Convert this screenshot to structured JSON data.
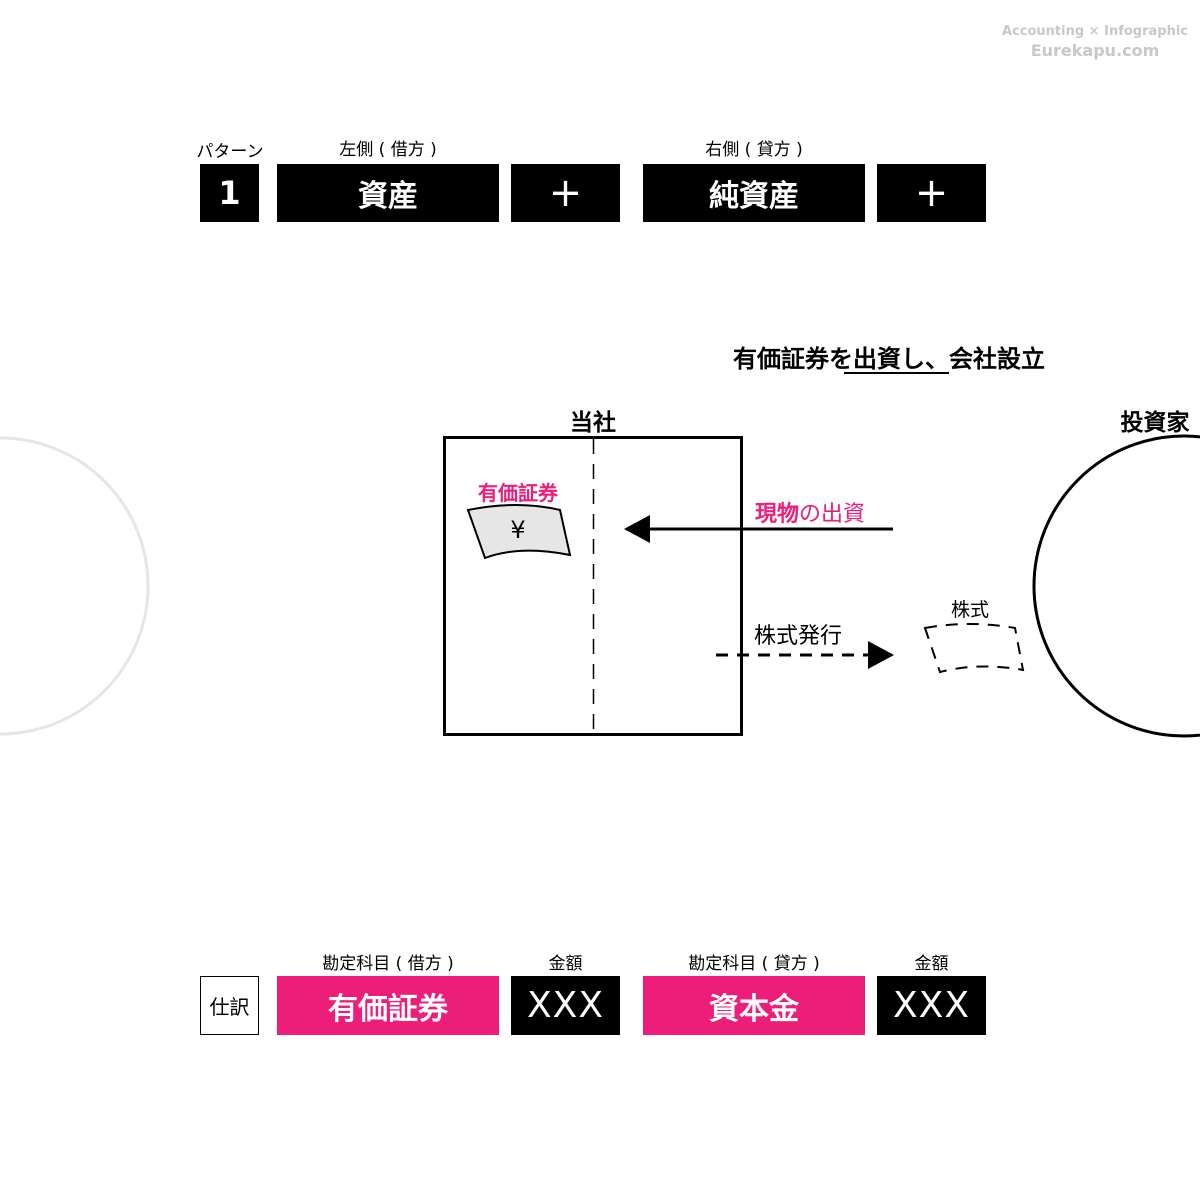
{
  "watermark": {
    "line1": "Accounting × Infographic",
    "line2": "Eurekapu.com"
  },
  "pattern_header": {
    "pattern_label": "パターン",
    "pattern_number": "1",
    "left_label": "左側 ( 借方 )",
    "left_account": "資産",
    "left_sign": "+",
    "right_label": "右側 ( 貸方 )",
    "right_account": "純資産",
    "right_sign": "+"
  },
  "scene": {
    "title_part1": "有価証券を",
    "title_part2": "出資し",
    "title_part3": "、会社設立",
    "company_label": "当社",
    "investor_label": "投資家",
    "asset_label": "有価証券",
    "asset_symbol": "¥",
    "inflow_label_pink": "現物",
    "inflow_label_rest": "の出資",
    "outflow_label": "株式発行",
    "share_label": "株式"
  },
  "journal": {
    "tag": "仕訳",
    "debit_header": "勘定科目 ( 借方 )",
    "debit_account": "有価証券",
    "debit_amount_header": "金額",
    "debit_amount": "XXX",
    "credit_header": "勘定科目 ( 貸方 )",
    "credit_account": "資本金",
    "credit_amount_header": "金額",
    "credit_amount": "XXX"
  },
  "colors": {
    "accent_pink": "#ec1e79",
    "black": "#000000",
    "watermark_gray": "#c8c8c8",
    "ghost_circle": "#e6e6e6",
    "asset_fill": "#e6e6e6"
  }
}
